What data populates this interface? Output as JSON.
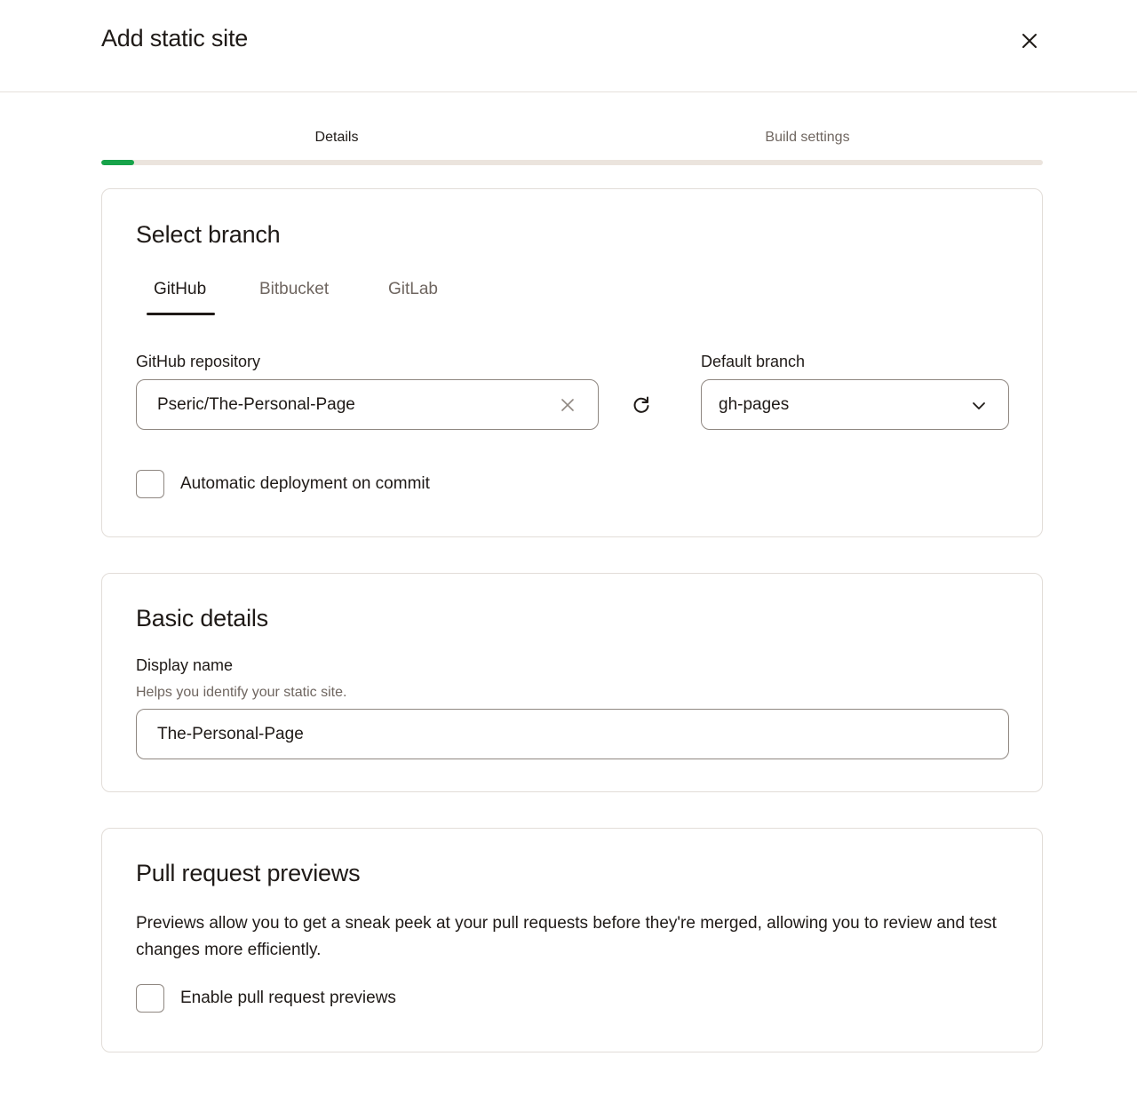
{
  "header": {
    "title": "Add static site",
    "close_icon": "close-icon"
  },
  "steps": {
    "items": [
      {
        "label": "Details",
        "active": true
      },
      {
        "label": "Build settings",
        "active": false
      }
    ],
    "progress_fraction": 0.035,
    "progress_color": "#17a34a"
  },
  "select_branch": {
    "title": "Select branch",
    "tabs": [
      {
        "label": "GitHub",
        "active": true
      },
      {
        "label": "Bitbucket",
        "active": false
      },
      {
        "label": "GitLab",
        "active": false
      }
    ],
    "repository": {
      "label": "GitHub repository",
      "value": "Pseric/The-Personal-Page",
      "clear_icon": "clear-icon"
    },
    "refresh_icon": "refresh-icon",
    "default_branch": {
      "label": "Default branch",
      "value": "gh-pages",
      "chevron_icon": "chevron-down-icon"
    },
    "auto_deploy": {
      "label": "Automatic deployment on commit",
      "checked": false
    }
  },
  "basic_details": {
    "title": "Basic details",
    "display_name": {
      "label": "Display name",
      "helper": "Helps you identify your static site.",
      "value": "The-Personal-Page"
    }
  },
  "pull_request_previews": {
    "title": "Pull request previews",
    "description": "Previews allow you to get a sneak peek at your pull requests before they're merged, allowing you to review and test changes more efficiently.",
    "enable": {
      "label": "Enable pull request previews",
      "checked": false
    }
  }
}
